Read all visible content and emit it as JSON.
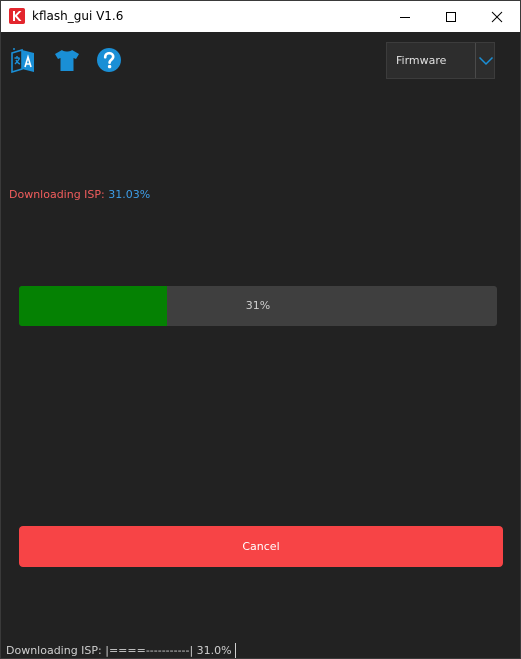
{
  "window": {
    "title": "kflash_gui V1.6",
    "app_icon": "kendryte-k-logo-icon",
    "minimize_icon": "minimize-icon",
    "maximize_icon": "maximize-icon",
    "close_icon": "close-icon"
  },
  "toolbar": {
    "icons": [
      "language-translate-icon",
      "tshirt-skin-icon",
      "help-question-icon"
    ]
  },
  "firmware_select": {
    "selected": "Firmware",
    "arrow_icon": "chevron-down-icon"
  },
  "status": {
    "label": "Downloading ISP:",
    "value": "31.03%",
    "label_color": "#f25d5d",
    "value_color": "#3d9ee8"
  },
  "progress": {
    "fraction": 0.31,
    "text": "31%",
    "fill_color": "#058103",
    "track_color": "#3f3f3f"
  },
  "cancel_button": {
    "label": "Cancel",
    "color": "#f74446"
  },
  "statusbar": {
    "text": "Downloading ISP: |====-----------| 31.0%"
  },
  "theme": {
    "background": "#222222",
    "accent": "#1a8fd6"
  }
}
